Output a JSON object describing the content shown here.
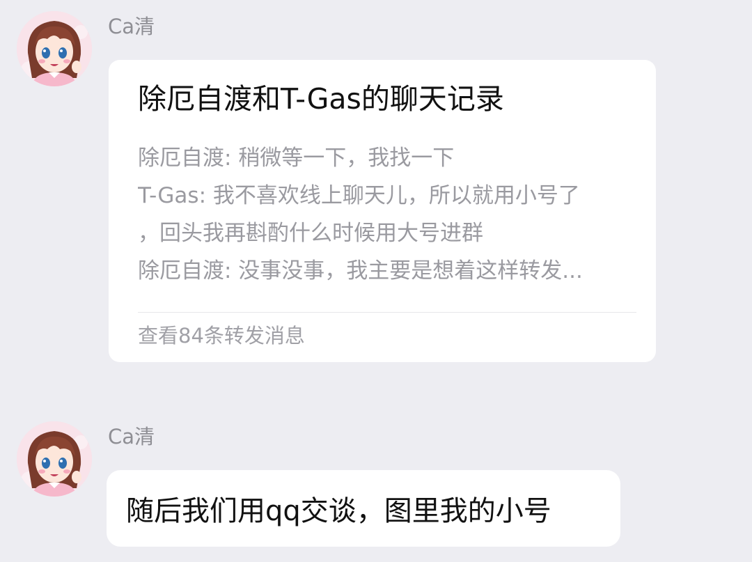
{
  "messages": [
    {
      "sender": "Ca清",
      "type": "forwarded_chat",
      "card": {
        "title": "除厄自渡和T-Gas的聊天记录",
        "preview_lines": [
          "除厄自渡: 稍微等一下，我找一下",
          "T-Gas: 我不喜欢线上聊天儿，所以就用小号了",
          "，回头我再斟酌什么时候用大号进群",
          "除厄自渡: 没事没事，我主要是想着这样转发..."
        ],
        "footer": "查看84条转发消息"
      }
    },
    {
      "sender": "Ca清",
      "type": "text",
      "text": "随后我们用qq交谈，图里我的小号"
    }
  ],
  "colors": {
    "background": "#ededf2",
    "bubble": "#ffffff",
    "name_text": "#8e8e94",
    "preview_text": "#9a9aa0"
  }
}
